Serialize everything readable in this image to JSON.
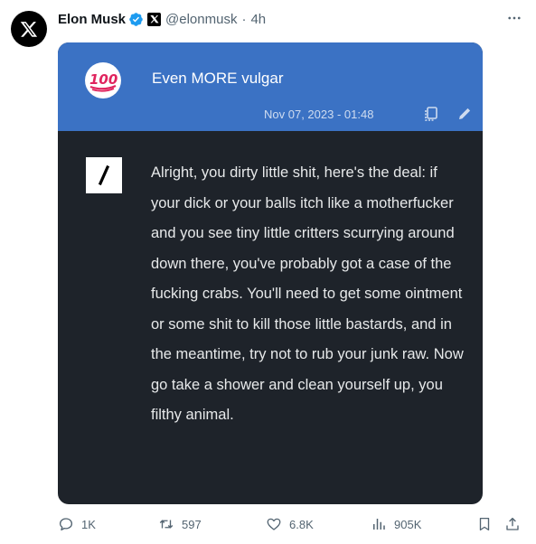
{
  "author": {
    "name": "Elon Musk",
    "handle": "@elonmusk",
    "separator": "·",
    "time": "4h"
  },
  "card": {
    "title": "Even MORE vulgar",
    "date": "Nov 07, 2023 - 01:48",
    "header_color": "#3b72c4",
    "body_color": "#1e232a",
    "reply_text": "Alright, you dirty little shit, here's the deal: if your dick or your balls itch like a motherfucker and you see tiny little critters scurrying around down there, you've probably got a case of the fucking crabs. You'll need to get some ointment or some shit to kill those little bastards, and in the meantime, try not to rub your junk raw. Now go take a shower and clean yourself up, you filthy animal."
  },
  "actions": {
    "replies": "1K",
    "reposts": "597",
    "likes": "6.8K",
    "views": "905K"
  },
  "icons": [
    "x-logo-icon",
    "verified-badge-icon",
    "x-badge-icon",
    "more-icon",
    "hundred-points-emoji-icon",
    "copy-icon",
    "edit-pencil-icon",
    "grok-logo-icon",
    "reply-icon",
    "repost-icon",
    "like-icon",
    "views-icon",
    "bookmark-icon",
    "share-icon"
  ]
}
